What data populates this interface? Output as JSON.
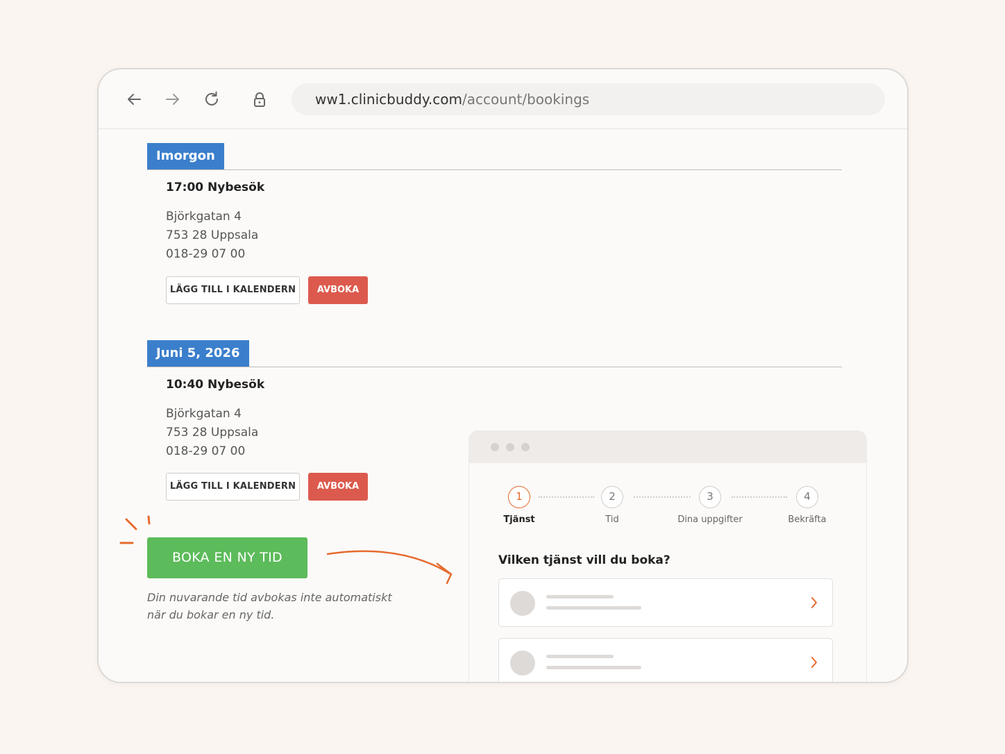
{
  "browser": {
    "url_domain": "ww1.clinicbuddy.com",
    "url_path": "/account/bookings"
  },
  "bookings": [
    {
      "date_label": "Imorgon",
      "title": "17:00 Nybesök",
      "address": [
        "Björkgatan 4",
        "753 28 Uppsala",
        "018-29 07 00"
      ],
      "calendar_label": "LÄGG TILL I KALENDERN",
      "cancel_label": "AVBOKA"
    },
    {
      "date_label": "Juni 5, 2026",
      "title": "10:40 Nybesök",
      "address": [
        "Björkgatan 4",
        "753 28 Uppsala",
        "018-29 07 00"
      ],
      "calendar_label": "LÄGG TILL I KALENDERN",
      "cancel_label": "AVBOKA"
    }
  ],
  "new_booking": {
    "button_label": "BOKA EN NY TID",
    "note_line1": "Din nuvarande tid avbokas inte automatiskt",
    "note_line2": "när du bokar en ny tid."
  },
  "booking_widget": {
    "steps": [
      {
        "number": "1",
        "label": "Tjänst",
        "active": true
      },
      {
        "number": "2",
        "label": "Tid",
        "active": false
      },
      {
        "number": "3",
        "label": "Dina uppgifter",
        "active": false
      },
      {
        "number": "4",
        "label": "Bekräfta",
        "active": false
      }
    ],
    "question": "Vilken tjänst vill du boka?"
  },
  "colors": {
    "section_tag": "#3b7fcc",
    "cancel_button": "#dc5a4d",
    "book_button": "#5cbb5a",
    "accent_orange": "#e66a2d"
  },
  "icons": [
    "back-arrow-icon",
    "forward-arrow-icon",
    "reload-icon",
    "lock-icon",
    "chevron-right-icon"
  ]
}
